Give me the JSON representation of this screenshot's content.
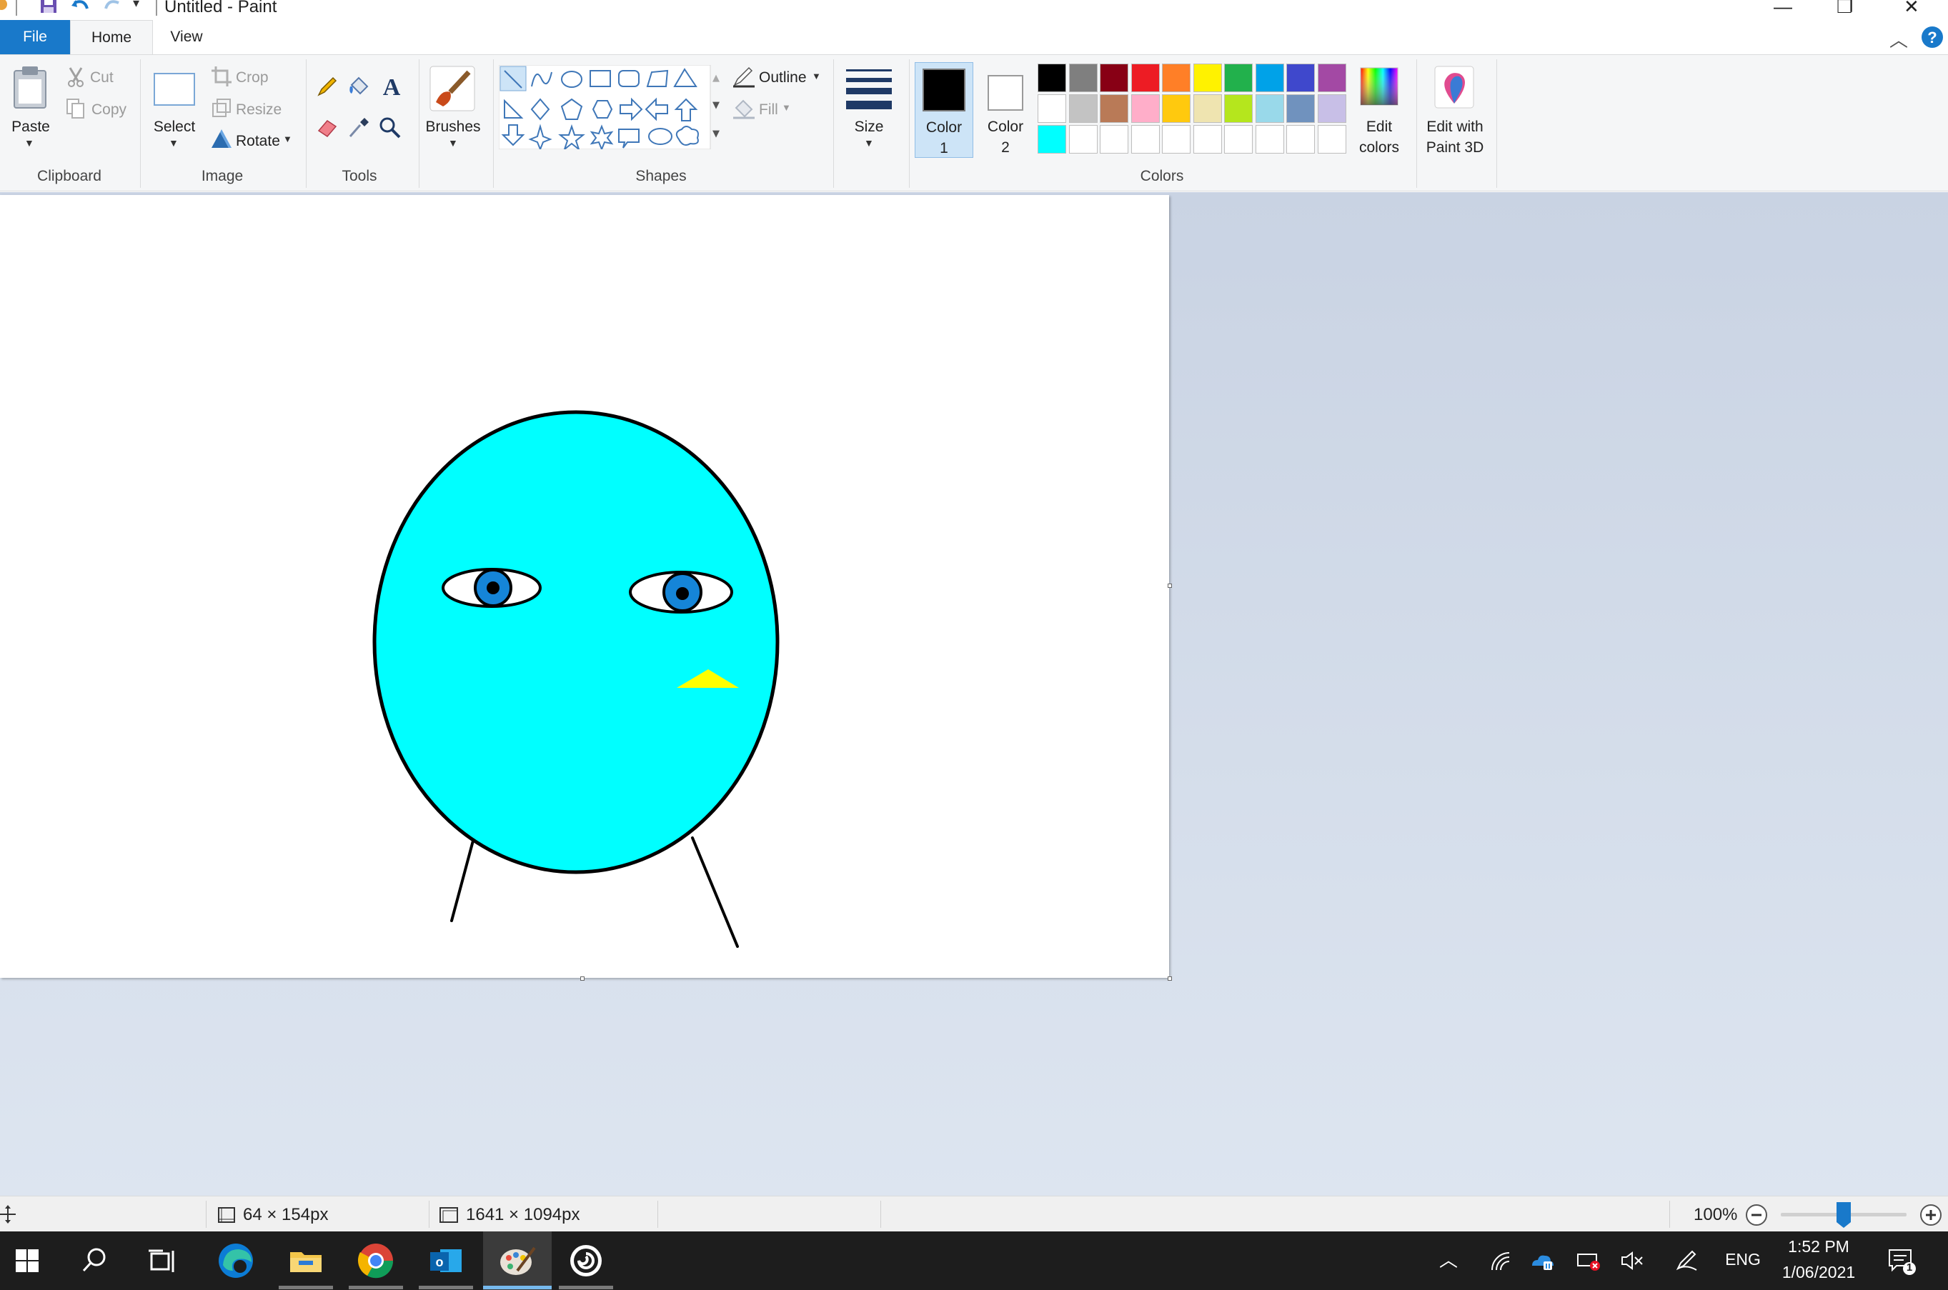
{
  "window": {
    "title": "Untitled - Paint",
    "controls": {
      "minimize": "—",
      "restore": "❐",
      "close": "✕"
    }
  },
  "tabs": [
    {
      "label": "File"
    },
    {
      "label": "Home"
    },
    {
      "label": "View"
    }
  ],
  "ribbon": {
    "clipboard": {
      "paste": "Paste",
      "cut": "Cut",
      "copy": "Copy",
      "group": "Clipboard"
    },
    "image": {
      "select": "Select",
      "crop": "Crop",
      "resize": "Resize",
      "rotate": "Rotate",
      "group": "Image"
    },
    "tools": {
      "group": "Tools"
    },
    "brushes": {
      "label": "Brushes"
    },
    "shapes": {
      "outline": "Outline",
      "fill": "Fill",
      "group": "Shapes"
    },
    "size": {
      "label": "Size"
    },
    "colors": {
      "color1": "Color",
      "color1_num": "1",
      "color2": "Color",
      "color2_num": "2",
      "edit": "Edit",
      "edit2": "colors",
      "paint3d": "Edit with",
      "paint3d2": "Paint 3D",
      "group": "Colors",
      "selected_color1": "#000000",
      "selected_color2": "#ffffff",
      "palette_row1": [
        "#000000",
        "#7f7f7f",
        "#880015",
        "#ed1c24",
        "#ff7f27",
        "#fff200",
        "#22b14c",
        "#00a2e8",
        "#3f48cc",
        "#a349a4"
      ],
      "palette_row2": [
        "#ffffff",
        "#c3c3c3",
        "#b97a57",
        "#ffaec9",
        "#ffc90e",
        "#efe4b0",
        "#b5e61d",
        "#99d9ea",
        "#7092be",
        "#c8bfe7"
      ],
      "palette_row3": [
        "#00ffff",
        "#ffffff",
        "#ffffff",
        "#ffffff",
        "#ffffff",
        "#ffffff",
        "#ffffff",
        "#ffffff",
        "#ffffff",
        "#ffffff"
      ]
    }
  },
  "drawing": {
    "face_color": "#00ffff",
    "iris_color": "#1585d8",
    "beak_color": "#ffff00"
  },
  "status": {
    "selection_size": "64 × 154px",
    "canvas_size": "1641 × 1094px",
    "zoom": "100%",
    "zoom_level": 0.5
  },
  "taskbar": {
    "lang": "ENG",
    "time": "1:52 PM",
    "date": "1/06/2021",
    "notifications": "1"
  }
}
